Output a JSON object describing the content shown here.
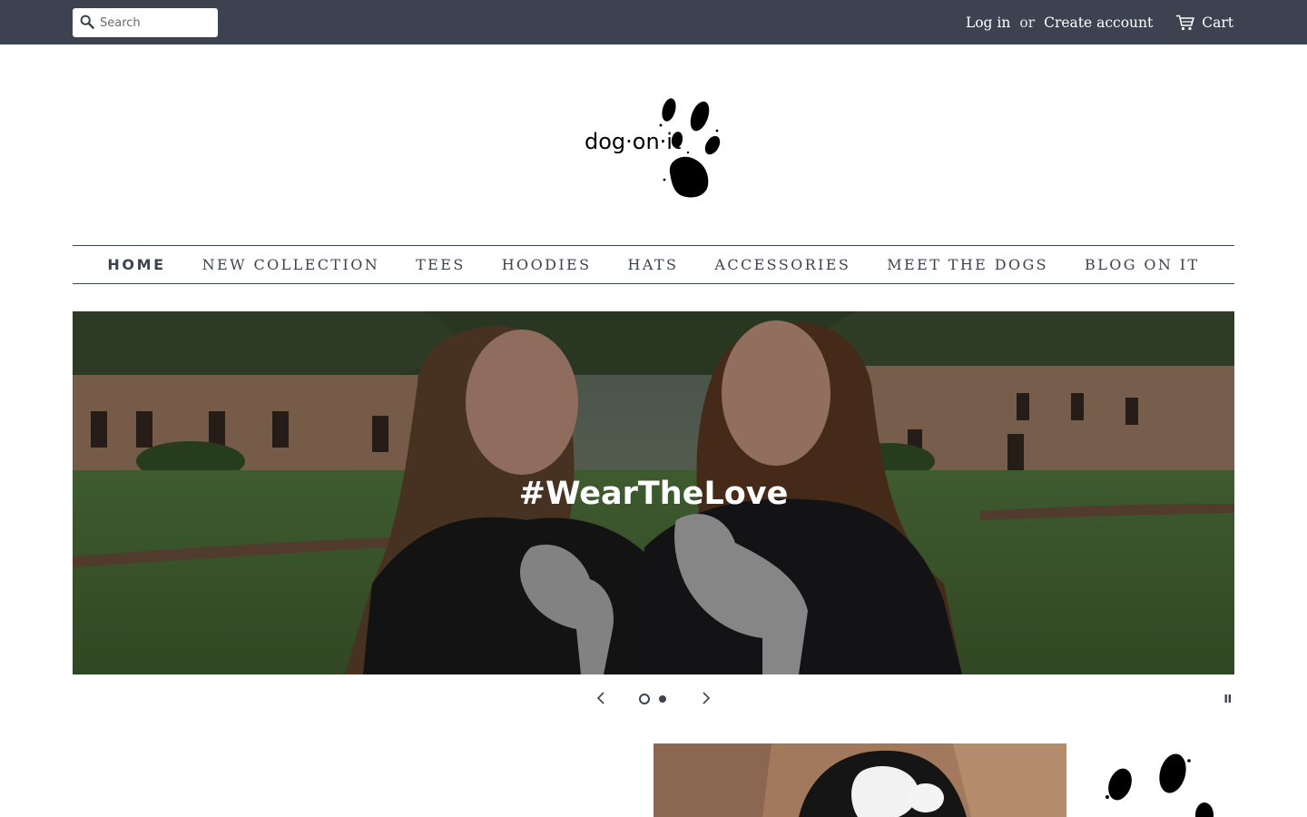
{
  "header": {
    "search_placeholder": "Search",
    "login_label": "Log in",
    "or_label": "or",
    "create_account_label": "Create account",
    "cart_label": "Cart"
  },
  "logo": {
    "alt": "dog·on·it"
  },
  "nav": {
    "items": [
      {
        "label": "HOME",
        "active": true
      },
      {
        "label": "NEW COLLECTION"
      },
      {
        "label": "TEES"
      },
      {
        "label": "HOODIES"
      },
      {
        "label": "HATS"
      },
      {
        "label": "ACCESSORIES"
      },
      {
        "label": "MEET THE DOGS"
      },
      {
        "label": "BLOG ON IT"
      }
    ]
  },
  "hero": {
    "title": "#WearTheLove",
    "slide_count": 2,
    "active_slide": 1
  },
  "colors": {
    "topbar": "#3d4250",
    "text": "#3d4250",
    "white": "#ffffff"
  },
  "icons": [
    "search-icon",
    "cart-icon",
    "chevron-left-icon",
    "chevron-right-icon",
    "pause-icon",
    "paw-icon"
  ]
}
